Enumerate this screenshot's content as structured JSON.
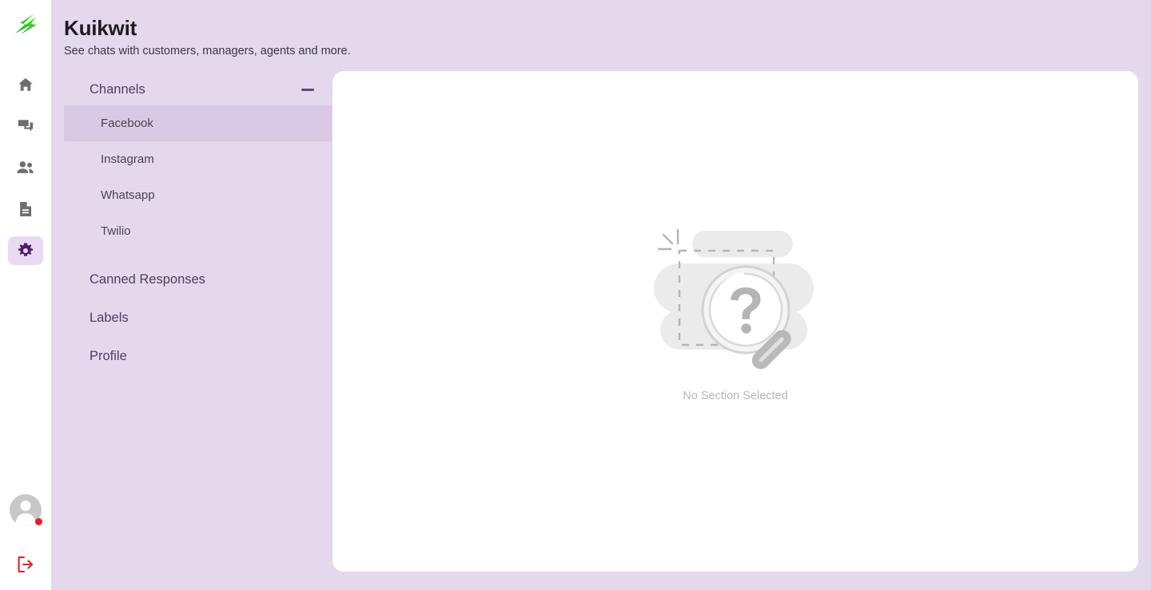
{
  "brand": {
    "logo_icon": "green-lightning-logo",
    "accent_green": "#3fc318",
    "accent_purple": "#4b1f72",
    "accent_red": "#ed1c24"
  },
  "rail": {
    "items": [
      {
        "icon": "home-icon",
        "name": "home",
        "active": false
      },
      {
        "icon": "chat-icon",
        "name": "chats",
        "active": false
      },
      {
        "icon": "people-icon",
        "name": "contacts",
        "active": false
      },
      {
        "icon": "document-icon",
        "name": "reports",
        "active": false
      },
      {
        "icon": "gear-icon",
        "name": "settings",
        "active": true
      }
    ],
    "avatar": {
      "icon": "avatar-icon",
      "status_color": "#ed1c24"
    },
    "logout": {
      "icon": "logout-icon"
    }
  },
  "header": {
    "title": "Kuikwit",
    "subtitle": "See chats with customers, managers, agents and more."
  },
  "settings": {
    "channels": {
      "label": "Channels",
      "collapse_icon": "minus-icon",
      "expanded": true,
      "items": [
        {
          "label": "Facebook",
          "selected": true
        },
        {
          "label": "Instagram",
          "selected": false
        },
        {
          "label": "Whatsapp",
          "selected": false
        },
        {
          "label": "Twilio",
          "selected": false
        }
      ]
    },
    "sections": [
      {
        "label": "Canned Responses"
      },
      {
        "label": "Labels"
      },
      {
        "label": "Profile"
      }
    ]
  },
  "content": {
    "empty_state": {
      "illustration": "magnifier-question-illustration",
      "text": "No Section Selected"
    }
  }
}
